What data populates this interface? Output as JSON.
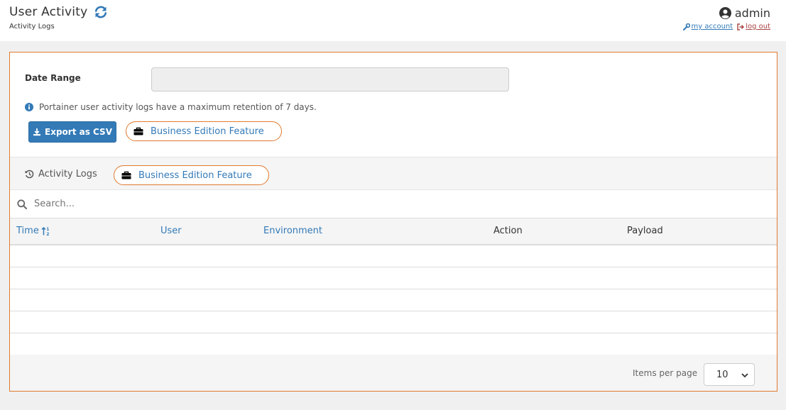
{
  "header": {
    "title": "User Activity",
    "breadcrumb": "Activity Logs",
    "user_name": "admin",
    "my_account_label": "my account",
    "log_out_label": "log out"
  },
  "filters": {
    "date_range_label": "Date Range",
    "date_range_value": "",
    "info_text": "Portainer user activity logs have a maximum retention of 7 days.",
    "export_label": "Export as CSV",
    "be_feature_label": "Business Edition Feature"
  },
  "table": {
    "section_title": "Activity Logs",
    "be_feature_label": "Business Edition Feature",
    "search_placeholder": "Search...",
    "columns": {
      "time": "Time",
      "user": "User",
      "environment": "Environment",
      "action": "Action",
      "payload": "Payload"
    },
    "rows": [],
    "items_per_page_label": "Items per page",
    "items_per_page_value": "10"
  },
  "colors": {
    "accent": "#337ab7",
    "border_highlight": "#e07a2f",
    "danger": "#a94442"
  },
  "icons": {
    "refresh": "refresh-icon",
    "user": "user-circle-icon",
    "wrench": "wrench-icon",
    "sign_out": "sign-out-icon",
    "info": "info-circle-icon",
    "download": "download-icon",
    "briefcase": "briefcase-icon",
    "history": "history-icon",
    "search": "search-icon",
    "sort": "sort-alpha-icon",
    "chevron": "chevron-down-icon"
  }
}
